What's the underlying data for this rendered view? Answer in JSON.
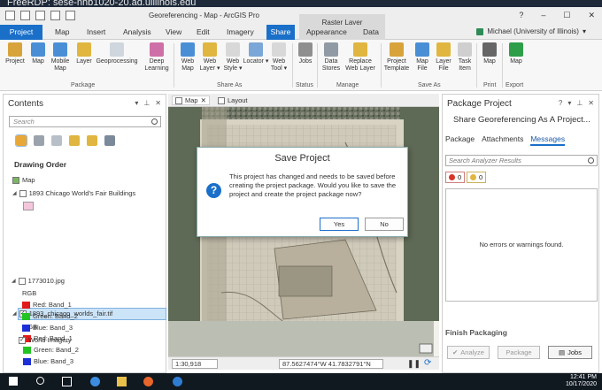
{
  "remote": {
    "title": "FreeRDP: sese-nhb1020-20.ad.uillinois.edu"
  },
  "window": {
    "title": "Georeferencing - Map - ArcGIS Pro",
    "context_tab_group": "Raster Layer",
    "help": "?",
    "minimize": "–",
    "maximize": "☐",
    "close": "✕"
  },
  "ribbon_tabs": {
    "project": "Project",
    "map": "Map",
    "insert": "Insert",
    "analysis": "Analysis",
    "view": "View",
    "edit": "Edit",
    "imagery": "Imagery",
    "share": "Share",
    "appearance": "Appearance",
    "data": "Data"
  },
  "user": {
    "name": "Michael (University of Illinois)",
    "caret": "▾"
  },
  "ribbon": {
    "package": {
      "label": "Package",
      "buttons": [
        "Project",
        "Map",
        "Mobile Map",
        "Layer",
        "Geoprocessing",
        "Deep Learning"
      ]
    },
    "share_as": {
      "label": "Share As",
      "buttons": [
        "Web Map",
        "Web Layer ▾",
        "Web Style ▾",
        "Locator ▾",
        "Web Tool ▾"
      ]
    },
    "status": {
      "label": "Status",
      "buttons": [
        "Jobs"
      ]
    },
    "manage": {
      "label": "Manage",
      "buttons": [
        "Data Stores",
        "Replace Web Layer"
      ]
    },
    "save_as": {
      "label": "Save As",
      "buttons": [
        "Project Template",
        "Map File",
        "Layer File",
        "Task Item"
      ]
    },
    "print": {
      "label": "Print",
      "buttons": [
        "Map"
      ]
    },
    "export": {
      "label": "Export",
      "buttons": [
        "Map"
      ]
    }
  },
  "contents": {
    "title": "Contents",
    "search_placeholder": "Search",
    "drawing_order": "Drawing Order",
    "map_label": "Map",
    "layer1": "1893 Chicago World's Fair Buildings",
    "layer2": "1893_chicago_worlds_fair.tif",
    "layer3": "1773010.jpg",
    "layer4": "World Imagery",
    "rgb": "RGB",
    "red": "Red:  Band_1",
    "green": "Green: Band_2",
    "blue": "Blue:  Band_3",
    "colors": {
      "red": "#e11b1b",
      "green": "#22c422",
      "blue": "#1d2fd6",
      "pink": "#f4c6dc"
    }
  },
  "view_tabs": {
    "map": "Map",
    "layout": "Layout"
  },
  "status": {
    "scale": "1:30,918",
    "coordinates": "87.5627474°W 41.7832791°N"
  },
  "dialog": {
    "title": "Save Project",
    "message": "This project has changed and needs to be saved before creating the project package. Would you like to save the project and create the project package now?",
    "yes": "Yes",
    "no": "No"
  },
  "package_pane": {
    "title": "Package Project",
    "subtitle": "Share Georeferencing As A Project...",
    "tabs": {
      "package": "Package",
      "attachments": "Attachments",
      "messages": "Messages"
    },
    "search_placeholder": "Search Analyzer Results",
    "errors": "0",
    "warnings": "0",
    "empty_message": "No errors or warnings found.",
    "finish": "Finish Packaging",
    "analyze": "Analyze",
    "package_btn": "Package",
    "jobs": "Jobs"
  },
  "taskbar": {
    "time": "12:41 PM",
    "date": "10/17/2020"
  }
}
